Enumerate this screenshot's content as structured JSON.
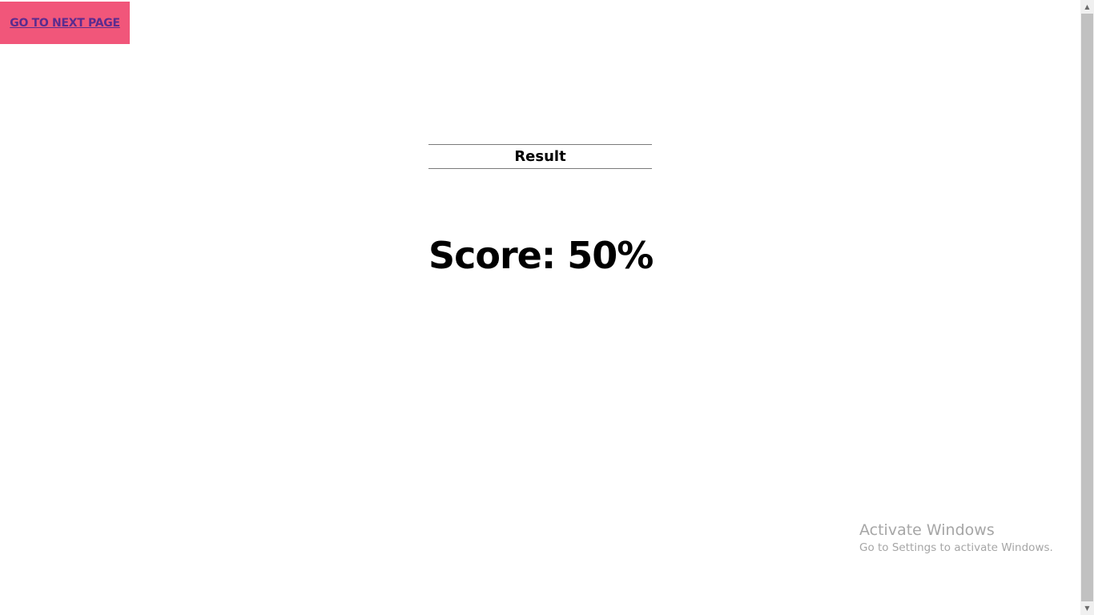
{
  "nav": {
    "next_page_label": "GO TO NEXT PAGE"
  },
  "result": {
    "heading": "Result",
    "score_text": "Score: 50%"
  },
  "os_watermark": {
    "title": "Activate Windows",
    "subtitle": "Go to Settings to activate Windows."
  },
  "scrollbar": {
    "up_icon": "▲",
    "down_icon": "▼"
  },
  "colors": {
    "button_background": "#f1567a",
    "link_text": "#5b2c8f",
    "text": "#000000",
    "watermark": "#a6a6a6"
  }
}
